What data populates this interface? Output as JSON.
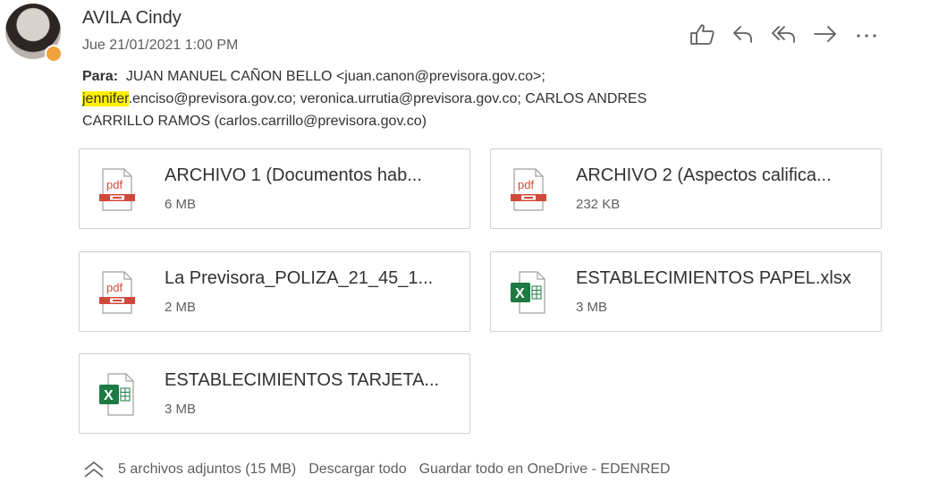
{
  "sender": {
    "name": "AVILA Cindy",
    "date": "Jue 21/01/2021 1:00 PM"
  },
  "recipients": {
    "label": "Para:",
    "line1": "JUAN MANUEL CAÑON BELLO <juan.canon@previsora.gov.co>;",
    "highlight": "jennifer",
    "line2": ".enciso@previsora.gov.co; veronica.urrutia@previsora.gov.co; CARLOS ANDRES",
    "line3": "CARRILLO RAMOS (carlos.carrillo@previsora.gov.co)"
  },
  "actions": [
    {
      "icon": "like-icon"
    },
    {
      "icon": "reply-icon"
    },
    {
      "icon": "reply-all-icon"
    },
    {
      "icon": "forward-icon"
    },
    {
      "icon": "more-icon"
    }
  ],
  "attachments": [
    {
      "name": "ARCHIVO 1 (Documentos hab...",
      "size": "6 MB",
      "icon": "pdf-icon"
    },
    {
      "name": "ARCHIVO 2 (Aspectos califica...",
      "size": "232 KB",
      "icon": "pdf-icon"
    },
    {
      "name": "La Previsora_POLIZA_21_45_1...",
      "size": "2 MB",
      "icon": "pdf-icon"
    },
    {
      "name": "ESTABLECIMIENTOS PAPEL.xlsx",
      "size": "3 MB",
      "icon": "excel-icon"
    },
    {
      "name": "ESTABLECIMIENTOS TARJETA...",
      "size": "3 MB",
      "icon": "excel-icon"
    }
  ],
  "footer": {
    "summary": "5 archivos adjuntos (15 MB)",
    "download_all": "Descargar todo",
    "save_onedrive": "Guardar todo en OneDrive - EDENRED"
  },
  "colors": {
    "pdf": "#d04a3c",
    "excel": "#1d7a43",
    "highlight": "#fff100"
  }
}
